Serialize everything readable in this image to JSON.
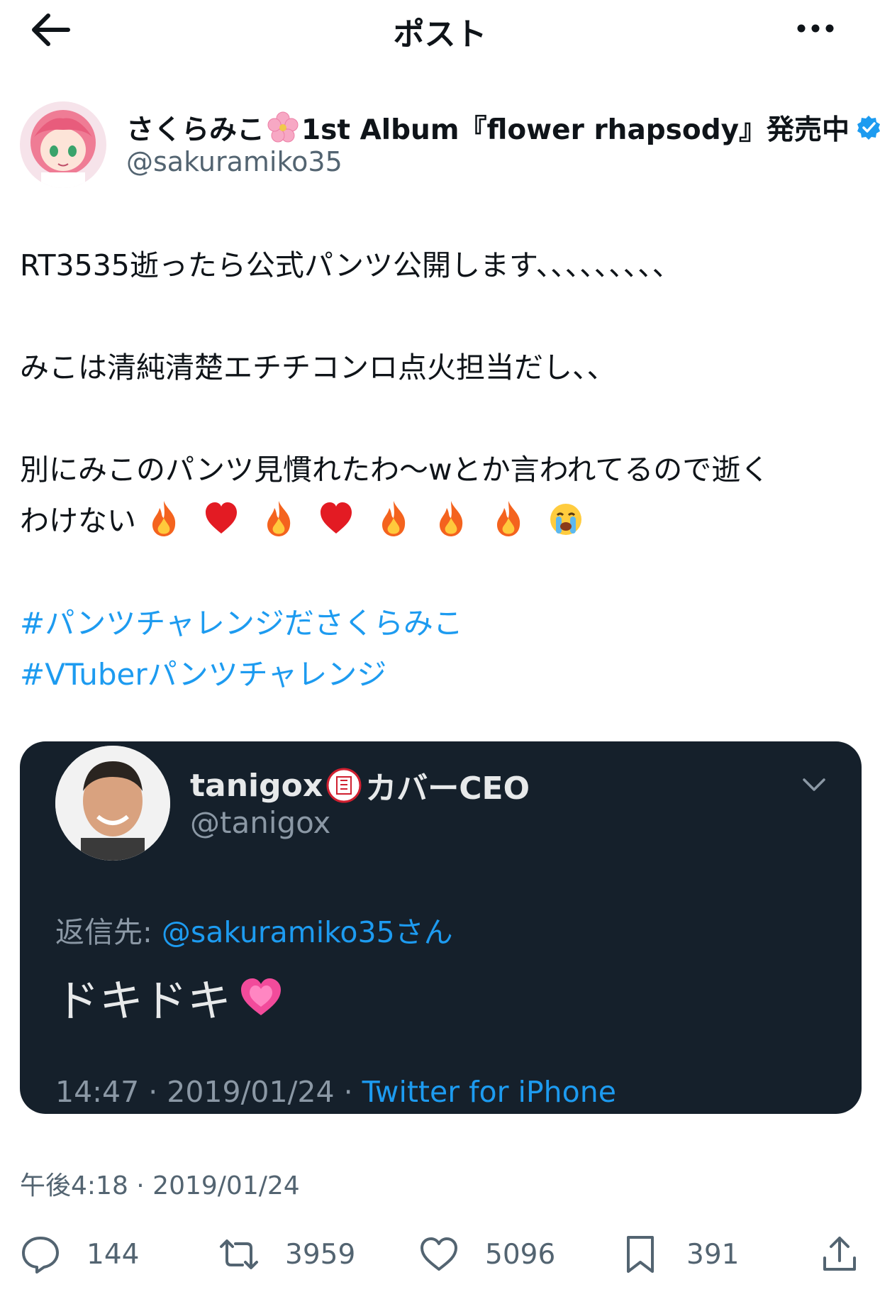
{
  "header": {
    "title": "ポスト",
    "back_icon": "arrow-left-icon",
    "more_icon": "more-horizontal-icon"
  },
  "author": {
    "name_part1": "さくらみこ",
    "name_part2": "1st Album『flower rhapsody』発売中",
    "handle": "@sakuramiko35",
    "verified": true,
    "name_emoji": "cherry-blossom-icon"
  },
  "tweet": {
    "line1": "RT3535逝ったら公式パンツ公開します、、、、、、、、、",
    "line2": "みこは清純清楚エチチコンロ点火担当だし、、",
    "line3": "別にみこのパンツ見慣れたわ〜wとか言われてるので逝く",
    "line4": "わけない",
    "line4_emojis": [
      "fire",
      "heart",
      "fire",
      "heart",
      "fire",
      "fire",
      "fire",
      "loudly-crying-face"
    ],
    "hashtags": [
      "#パンツチャレンジださくらみこ",
      "#VTuberパンツチャレンジ"
    ]
  },
  "quote": {
    "name_part1": "tanigox",
    "name_part2": "カバーCEO",
    "handle": "@tanigox",
    "reply_prefix": "返信先: ",
    "reply_mention": "@sakuramiko35さん",
    "body": "ドキドキ",
    "meta_prefix": "14:47 · 2019/01/24 · ",
    "meta_source": "Twitter for iPhone"
  },
  "timestamp": "午後4:18 · 2019/01/24",
  "actions": {
    "replies": "144",
    "reposts": "3959",
    "likes": "5096",
    "bookmarks": "391"
  },
  "colors": {
    "accent": "#1d9bf0",
    "text": "#0f1419",
    "muted": "#536471",
    "quote_bg": "#15202b"
  }
}
